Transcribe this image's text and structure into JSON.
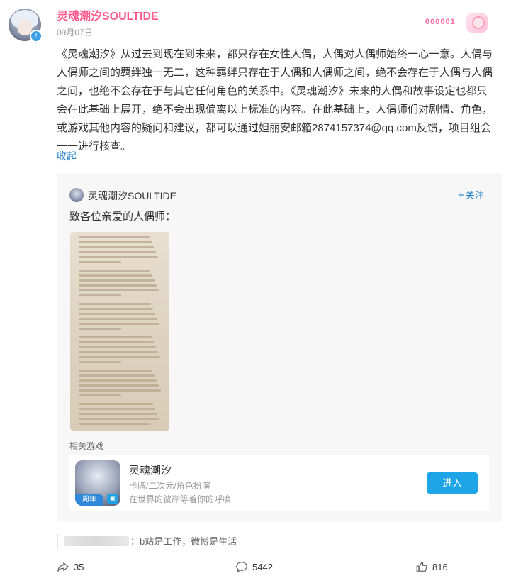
{
  "post": {
    "author": "灵魂潮汐SOULTIDE",
    "date": "09月07日",
    "badge_text": "000001",
    "body": "《灵魂潮汐》从过去到现在到未来，都只存在女性人偶，人偶对人偶师始终一心一意。人偶与人偶师之间的羁绊独一无二，这种羁绊只存在于人偶和人偶师之间，绝不会存在于人偶与人偶之间，也绝不会存在于与其它任何角色的关系中。《灵魂潮汐》未来的人偶和故事设定也都只会在此基础上展开，绝不会出现偏离以上标准的内容。在此基础上，人偶师们对剧情、角色，或游戏其他内容的疑问和建议，都可以通过妲丽安邮箱2874157374@qq.com反馈，项目组会一一进行核查。",
    "collapse_label": "收起"
  },
  "repost": {
    "author": "灵魂潮汐SOULTIDE",
    "follow_label": "关注",
    "title": "致各位亲爱的人偶师：",
    "related_label": "相关游戏"
  },
  "game": {
    "name": "灵魂潮汐",
    "tags": "卡牌/二次元/角色扮演",
    "desc": "在世界的彼岸等着你的呼唤",
    "icon_tag": "周年",
    "enter_label": "进入"
  },
  "comment": {
    "text": "：b站是工作，微博是生活"
  },
  "actions": {
    "shares": "35",
    "comments": "5442",
    "likes": "816"
  },
  "colors": {
    "accent": "#ff5c8d",
    "link": "#1a7cc9",
    "button": "#1ea5e8"
  },
  "icons": [
    "verified-icon",
    "plus-icon",
    "share-icon",
    "comment-icon",
    "like-icon"
  ]
}
